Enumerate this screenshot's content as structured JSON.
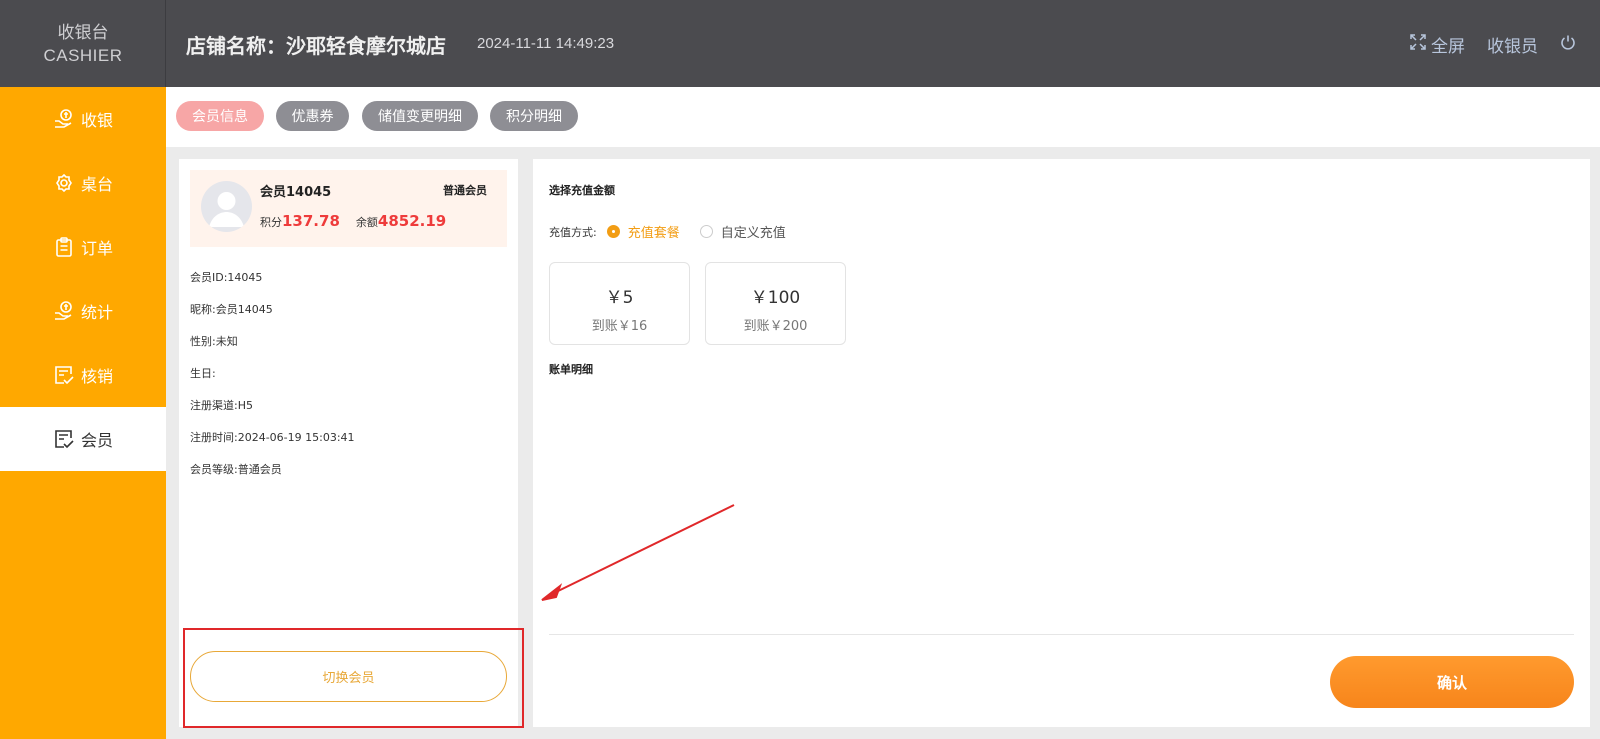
{
  "brand": {
    "line1": "收银台",
    "line2": "CASHIER"
  },
  "header": {
    "store_name": "店铺名称：沙耶轻食摩尔城店",
    "datetime": "2024-11-11 14:49:23",
    "fullscreen_label": "全屏",
    "cashier_label": "收银员"
  },
  "sidebar": {
    "items": [
      {
        "label": "收银",
        "icon": "cashier-hand-icon"
      },
      {
        "label": "桌台",
        "icon": "table-gear-icon"
      },
      {
        "label": "订单",
        "icon": "order-clipboard-icon"
      },
      {
        "label": "统计",
        "icon": "stats-hand-icon"
      },
      {
        "label": "核销",
        "icon": "verify-check-icon"
      },
      {
        "label": "会员",
        "icon": "member-check-icon",
        "active": true
      }
    ]
  },
  "tabs": [
    {
      "label": "会员信息",
      "active": true
    },
    {
      "label": "优惠券"
    },
    {
      "label": "储值变更明细"
    },
    {
      "label": "积分明细"
    }
  ],
  "member": {
    "name": "会员14045",
    "level": "普通会员",
    "points_label": "积分",
    "points_value": "137.78",
    "balance_label": "余额",
    "balance_value": "4852.19",
    "info": [
      "会员ID:14045",
      "昵称:会员14045",
      "性别:未知",
      "生日:",
      "注册渠道:H5",
      "注册时间:2024-06-19 15:03:41",
      "会员等级:普通会员"
    ],
    "switch_label": "切换会员"
  },
  "recharge": {
    "title": "选择充值金额",
    "method_label": "充值方式:",
    "options": [
      {
        "label": "充值套餐",
        "selected": true
      },
      {
        "label": "自定义充值",
        "selected": false
      }
    ],
    "packages": [
      {
        "amount": "￥5",
        "credit": "到账￥16"
      },
      {
        "amount": "￥100",
        "credit": "到账￥200"
      }
    ],
    "bill_title": "账单明细",
    "confirm_label": "确认"
  },
  "colors": {
    "header_bg": "#4b4b4f",
    "sidebar_bg": "#ffa800",
    "accent_orange": "#f29d14",
    "price_red": "#ee3b3b",
    "active_tab": "#f7a6a6",
    "annotation_red": "#e0282a"
  }
}
